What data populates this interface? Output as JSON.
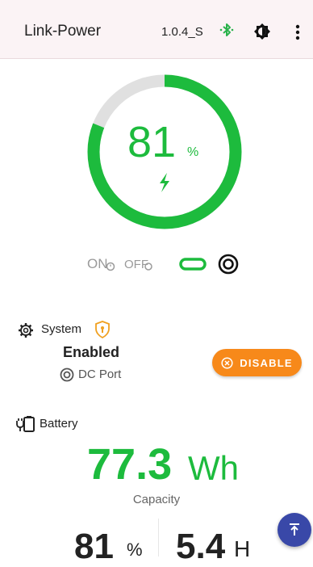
{
  "appbar": {
    "title": "Link-Power",
    "version": "1.0.4_S",
    "icons": [
      "bluetooth-icon",
      "brightness-icon",
      "more-vert-icon"
    ]
  },
  "gauge": {
    "percent": 81,
    "value_text": "81",
    "unit": "%",
    "charging": true,
    "colors": {
      "fill": "#1dbb3d",
      "track": "#e0e0e0"
    }
  },
  "modes": {
    "on_label": "ON",
    "off_label": "OFF",
    "icons": [
      "timer-on-icon",
      "timer-off-icon",
      "link-icon",
      "ring-icon"
    ]
  },
  "system": {
    "label": "System",
    "status": "Enabled",
    "port_label": "DC Port",
    "disable_button": "DISABLE",
    "colors": {
      "button": "#f7891a",
      "shield": "#f0a020"
    }
  },
  "battery": {
    "label": "Battery",
    "capacity_value": "77.3",
    "capacity_unit": "Wh",
    "capacity_label": "Capacity",
    "percent_value": "81",
    "percent_unit": "%",
    "time_value": "5.4",
    "time_unit": "H"
  },
  "fab": {
    "icon": "scroll-top-icon",
    "color": "#3948a8"
  }
}
